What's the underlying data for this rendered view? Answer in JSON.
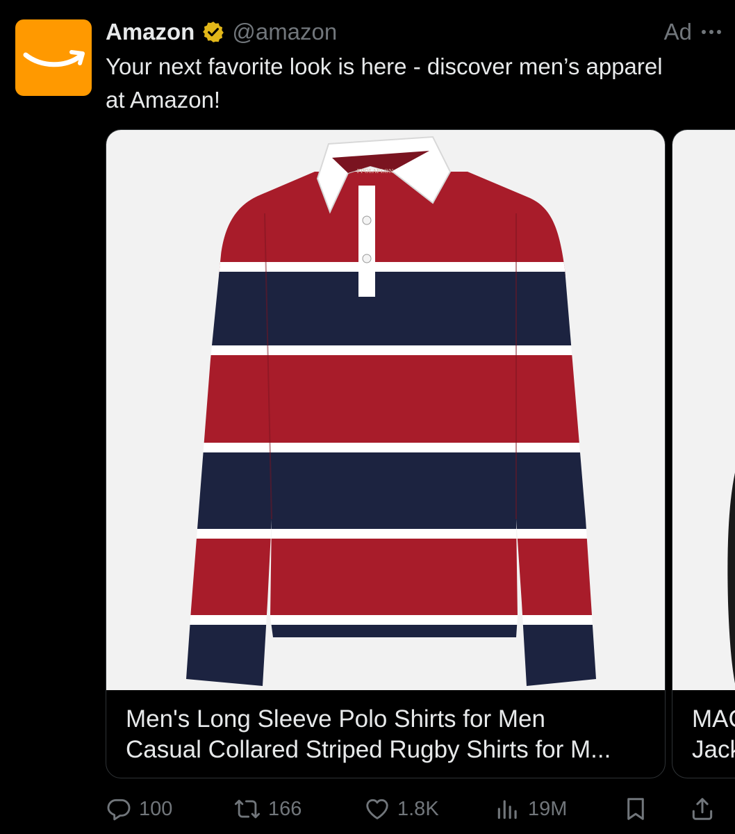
{
  "post": {
    "author_name": "Amazon",
    "handle": "@amazon",
    "ad_label": "Ad",
    "text": "Your next favorite look is here - discover men’s apparel at Amazon!",
    "brand_color": "#ff9900",
    "verified_color": "#e2b719"
  },
  "carousel": {
    "cards": [
      {
        "title_line1": "Men's Long Sleeve Polo Shirts for Men",
        "title_line2": "Casual Collared Striped Rugby Shirts for M...",
        "image": "striped-rugby-polo-shirt",
        "colors": {
          "red": "#a81c2a",
          "navy": "#1c2340",
          "white": "#ffffff"
        }
      },
      {
        "title_line1": "MAC",
        "title_line2": "Jack",
        "image": "jacket"
      }
    ]
  },
  "actions": {
    "replies": "100",
    "reposts": "166",
    "likes": "1.8K",
    "views": "19M"
  }
}
